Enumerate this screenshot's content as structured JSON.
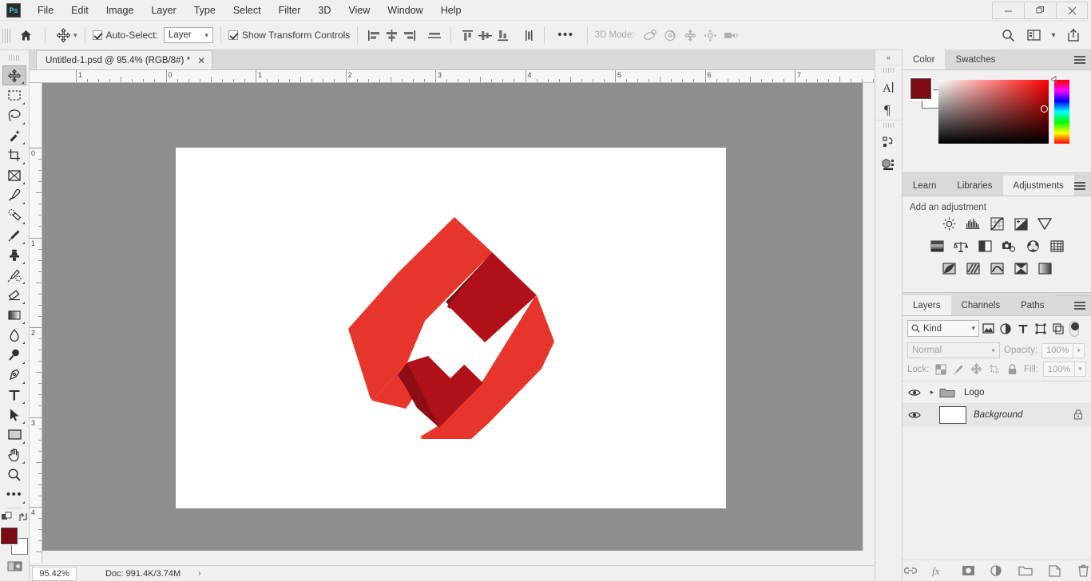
{
  "app": {
    "name": "Adobe Photoshop",
    "logo_text": "Ps"
  },
  "menubar": {
    "items": [
      "File",
      "Edit",
      "Image",
      "Layer",
      "Type",
      "Select",
      "Filter",
      "3D",
      "View",
      "Window",
      "Help"
    ]
  },
  "window_controls": {
    "minimize": "–",
    "restore": "❐",
    "close": "✕"
  },
  "options_bar": {
    "home_icon": "home-icon",
    "tool_icon": "move-tool-icon",
    "auto_select_label": "Auto-Select:",
    "auto_select_checked": true,
    "auto_select_scope": "Layer",
    "show_transform_label": "Show Transform Controls",
    "show_transform_checked": true,
    "align_icons": [
      "align-left-edges",
      "align-horizontal-centers",
      "align-right-edges",
      "align-middle-rule"
    ],
    "distribute_icons": [
      "align-top-edges",
      "align-vertical-centers",
      "align-bottom-edges",
      "distribute-vertical"
    ],
    "overflow_label": "•••",
    "mode3d_label": "3D Mode:",
    "mode3d_icons": [
      "orbit-3d-icon",
      "roll-3d-icon",
      "pan-3d-icon",
      "slide-3d-icon",
      "camera-3d-icon"
    ],
    "right_icons": [
      "search-icon",
      "workspace-icon",
      "chevron-down-icon",
      "share-icon"
    ]
  },
  "toolbar": {
    "tools": [
      {
        "name": "move-tool",
        "active": true
      },
      {
        "name": "rectangular-marquee-tool",
        "active": false
      },
      {
        "name": "lasso-tool",
        "active": false
      },
      {
        "name": "magic-wand-tool",
        "active": false
      },
      {
        "name": "crop-tool",
        "active": false
      },
      {
        "name": "frame-tool",
        "active": false
      },
      {
        "name": "eyedropper-tool",
        "active": false
      },
      {
        "name": "spot-healing-brush-tool",
        "active": false
      },
      {
        "name": "brush-tool",
        "active": false
      },
      {
        "name": "clone-stamp-tool",
        "active": false
      },
      {
        "name": "history-brush-tool",
        "active": false
      },
      {
        "name": "eraser-tool",
        "active": false
      },
      {
        "name": "gradient-tool",
        "active": false
      },
      {
        "name": "blur-tool",
        "active": false
      },
      {
        "name": "dodge-tool",
        "active": false
      },
      {
        "name": "pen-tool",
        "active": false
      },
      {
        "name": "horizontal-type-tool",
        "active": false
      },
      {
        "name": "path-selection-tool",
        "active": false
      },
      {
        "name": "rectangle-tool",
        "active": false
      },
      {
        "name": "hand-tool",
        "active": false
      },
      {
        "name": "zoom-tool",
        "active": false
      },
      {
        "name": "edit-toolbar-tool",
        "active": false
      }
    ],
    "foreground_color": "#7d0c14",
    "background_color": "#ffffff",
    "quick_mask_icon": "quick-mask-icon"
  },
  "document": {
    "tab_title": "Untitled-1.psd @ 95.4% (RGB/8#) *",
    "close_label": "✕",
    "collapse_label": "»"
  },
  "rulers": {
    "horizontal_labels": [
      "1",
      "0",
      "1",
      "2",
      "3",
      "4",
      "5",
      "6",
      "7"
    ],
    "vertical_labels": [
      "0",
      "1",
      "2",
      "3",
      "4"
    ],
    "unit": "inches"
  },
  "canvas": {
    "background_color": "#8e8e8e",
    "artboard_color": "#ffffff",
    "artwork_name": "red-origami-diamond-logo",
    "artwork_colors": {
      "bright_red": "#e8352b",
      "dark_red": "#b01119",
      "deep_shadow_red": "#8c0d14"
    }
  },
  "status_bar": {
    "zoom": "95.42%",
    "doc_info": "Doc: 991.4K/3.74M",
    "chevron": "›"
  },
  "icon_rail": {
    "collapse_label": "«",
    "groups": [
      [
        "character-panel-icon",
        "paragraph-panel-icon"
      ],
      [
        "paths-panel-icon",
        "3d-panel-icon"
      ]
    ]
  },
  "color_panel": {
    "tabs": [
      {
        "label": "Color",
        "active": true
      },
      {
        "label": "Swatches",
        "active": false
      }
    ],
    "menu_icon": "panel-menu-icon",
    "foreground_color": "#7d0c14",
    "background_color": "#ffffff",
    "hue": "#ff0000"
  },
  "adjustments_panel": {
    "tabs": [
      {
        "label": "Learn",
        "active": false
      },
      {
        "label": "Libraries",
        "active": false
      },
      {
        "label": "Adjustments",
        "active": true
      }
    ],
    "menu_icon": "panel-menu-icon",
    "heading": "Add an adjustment",
    "rows": [
      [
        "brightness-contrast-icon",
        "levels-icon",
        "curves-icon",
        "exposure-icon",
        "vibrance-icon"
      ],
      [
        "hue-saturation-icon",
        "color-balance-icon",
        "black-white-icon",
        "photo-filter-icon",
        "channel-mixer-icon",
        "color-lookup-icon"
      ],
      [
        "invert-icon",
        "posterize-icon",
        "threshold-icon",
        "gradient-map-icon",
        "selective-color-icon"
      ]
    ]
  },
  "layers_panel": {
    "tabs": [
      {
        "label": "Layers",
        "active": true
      },
      {
        "label": "Channels",
        "active": false
      },
      {
        "label": "Paths",
        "active": false
      }
    ],
    "menu_icon": "panel-menu-icon",
    "filter": {
      "kind_label": "Kind",
      "search_icon": "search-icon",
      "type_icons": [
        "filter-pixel-icon",
        "filter-adjustment-icon",
        "filter-type-icon",
        "filter-shape-icon",
        "filter-smart-object-icon"
      ],
      "toggle_on": true
    },
    "blend_mode": "Normal",
    "opacity_label": "Opacity:",
    "opacity_value": "100%",
    "lock_label": "Lock:",
    "lock_icons": [
      "lock-transparent-pixels-icon",
      "lock-image-pixels-icon",
      "lock-position-icon",
      "lock-artboard-nesting-icon",
      "lock-all-icon"
    ],
    "fill_label": "Fill:",
    "fill_value": "100%",
    "layers": [
      {
        "name": "Logo",
        "type": "group",
        "visible": true,
        "italic": false,
        "locked": false,
        "expanded": false
      },
      {
        "name": "Background",
        "type": "image",
        "visible": true,
        "italic": true,
        "locked": true,
        "expanded": false
      }
    ],
    "bottom_icons": [
      "link-layers-icon",
      "layer-style-fx-icon",
      "add-layer-mask-icon",
      "new-adjustment-layer-icon",
      "new-group-icon",
      "new-layer-icon",
      "delete-layer-icon"
    ]
  }
}
